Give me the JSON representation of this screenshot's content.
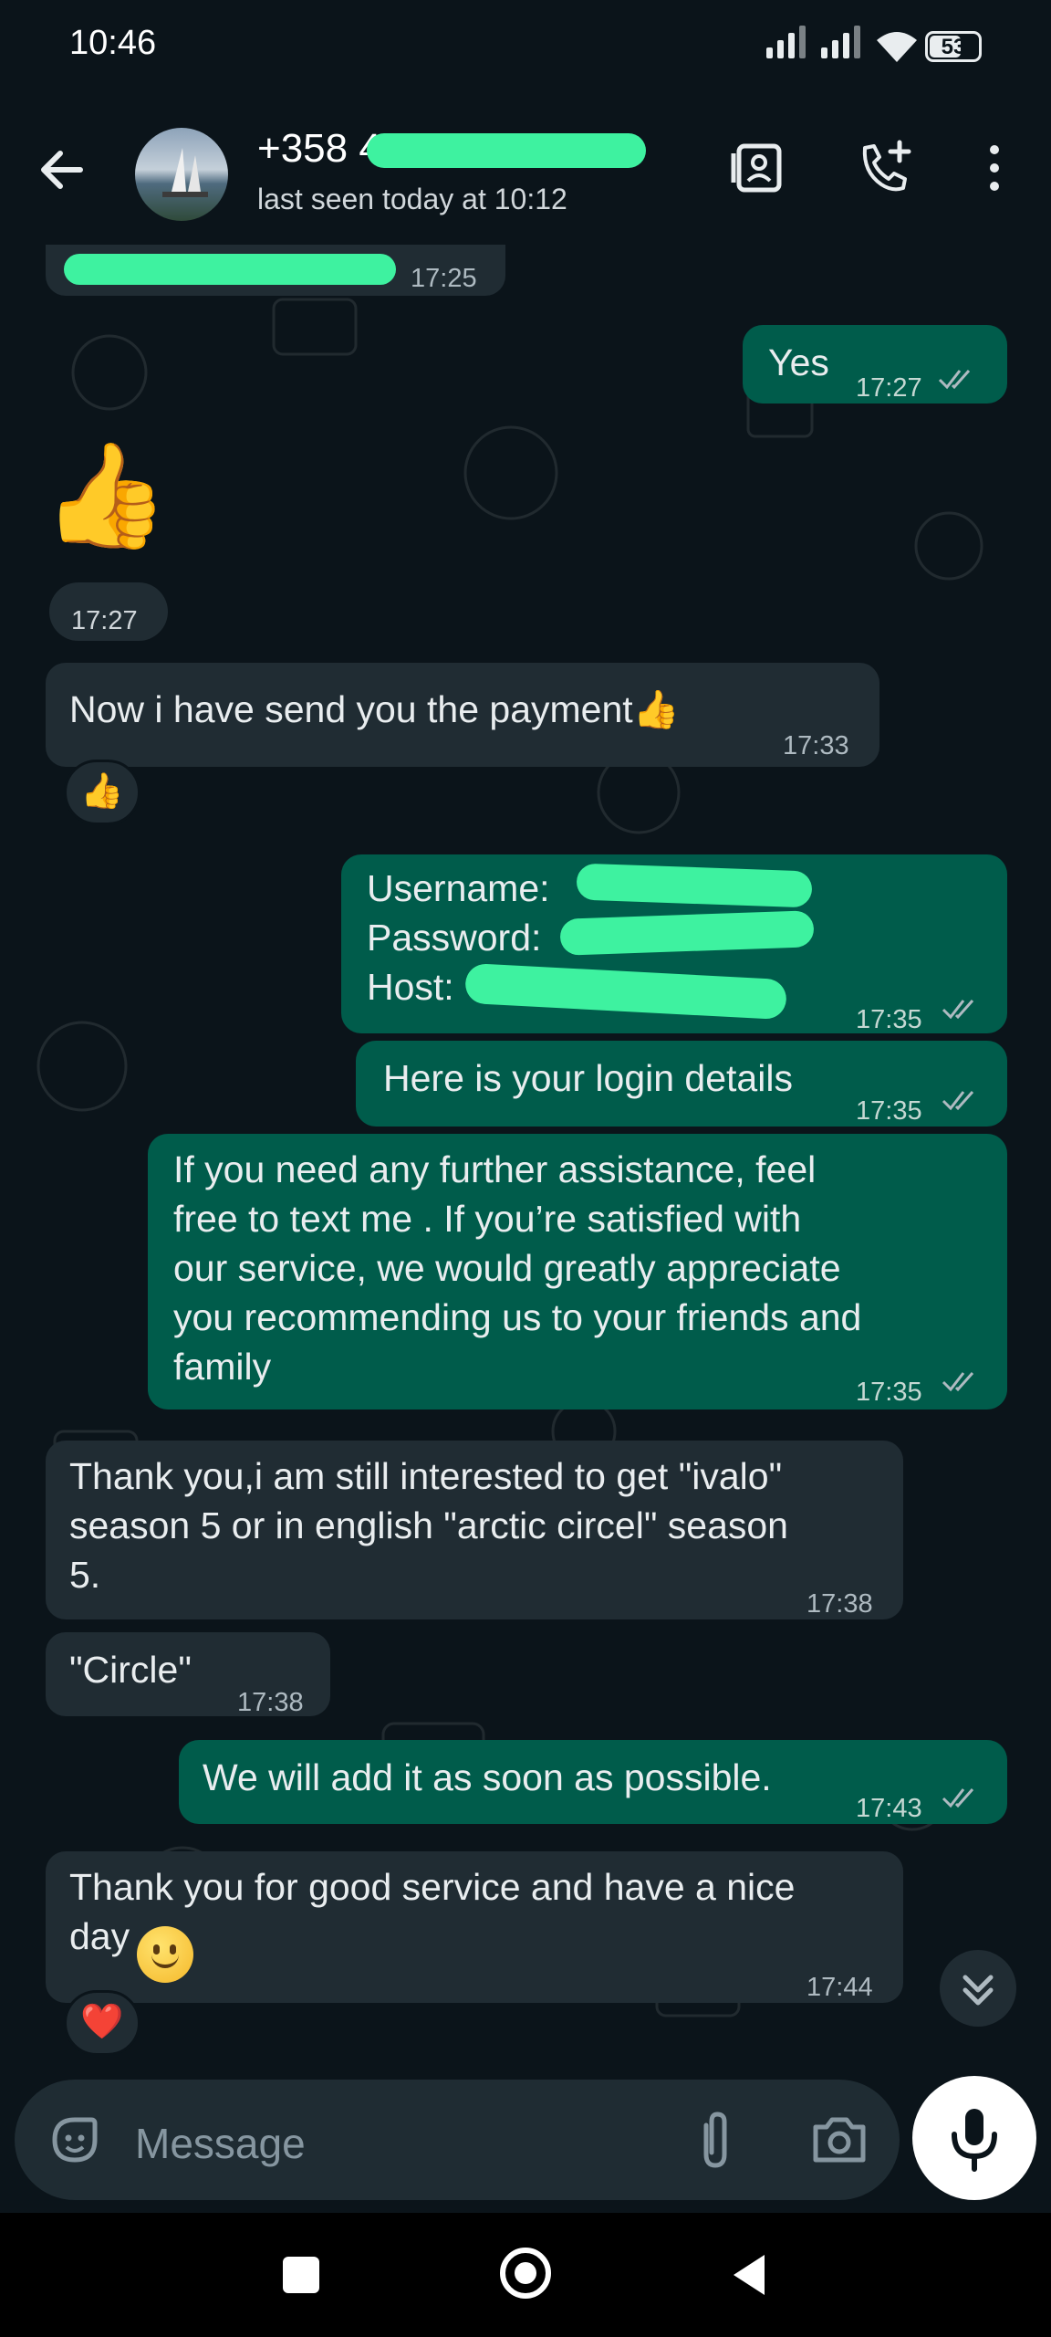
{
  "status_bar": {
    "time": "10:46",
    "battery": "53"
  },
  "header": {
    "name": "+358 40 7384777",
    "last_seen": "last seen today at 10:12"
  },
  "messages": [
    {
      "text": "",
      "time": "17:25"
    },
    {
      "text": "Yes",
      "time": "17:27"
    },
    {
      "text": "👍",
      "time": "17:27"
    },
    {
      "text": "Now i have send you the payment👍",
      "time": "17:33",
      "reaction": "👍"
    },
    {
      "lines": [
        "Username: ",
        "Password: ",
        "Host: "
      ],
      "time": "17:35"
    },
    {
      "text": "Here is your login details",
      "time": "17:35"
    },
    {
      "text": "If you need any further assistance, feel\nfree to text me . If you’re satisfied with\nour service, we would greatly appreciate\nyou recommending us to your friends and\nfamily",
      "time": "17:35"
    },
    {
      "text": "Thank you,i am still interested to get \"ivalo\"\nseason 5 or in english  \"arctic circel\" season\n5.",
      "time": "17:38"
    },
    {
      "text": "\"Circle\"",
      "time": "17:38"
    },
    {
      "text": "We will add it as soon as possible.",
      "time": "17:43"
    },
    {
      "text": "Thank you for good service and have a nice\nday",
      "time": "17:44",
      "reaction": "❤️"
    }
  ],
  "composer": {
    "placeholder": "Message"
  },
  "icons": {
    "back": "arrow-left-icon",
    "contact_card": "contact-card-icon",
    "add_call": "add-call-icon",
    "menu": "more-vert-icon",
    "sticker": "sticker-icon",
    "attach": "paperclip-icon",
    "camera": "camera-icon",
    "mic": "mic-icon",
    "scroll": "double-chevron-down-icon"
  },
  "colors": {
    "incoming": "#202c33",
    "outgoing": "#005c4b",
    "background": "#0b141a",
    "redaction": "#3ef2a0"
  }
}
